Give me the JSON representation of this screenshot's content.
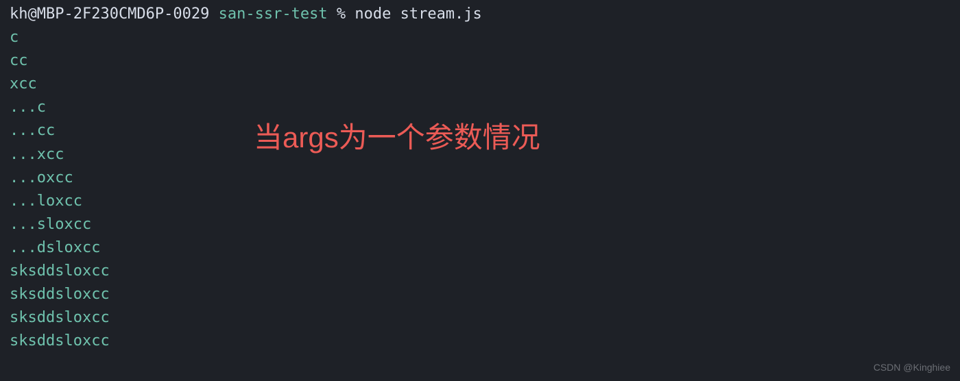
{
  "prompt": {
    "user_host": "kh@MBP-2F230CMD6P-0029",
    "directory": "san-ssr-test",
    "symbol": "%",
    "command": "node stream.js"
  },
  "output_lines": [
    "c",
    "cc",
    "xcc",
    "...c",
    "...cc",
    "...xcc",
    "...oxcc",
    "...loxcc",
    "...sloxcc",
    "...dsloxcc",
    "sksddsloxcc",
    "sksddsloxcc",
    "sksddsloxcc",
    "sksddsloxcc"
  ],
  "annotation_text": "当args为一个参数情况",
  "watermark_text": "CSDN @Kinghiee"
}
